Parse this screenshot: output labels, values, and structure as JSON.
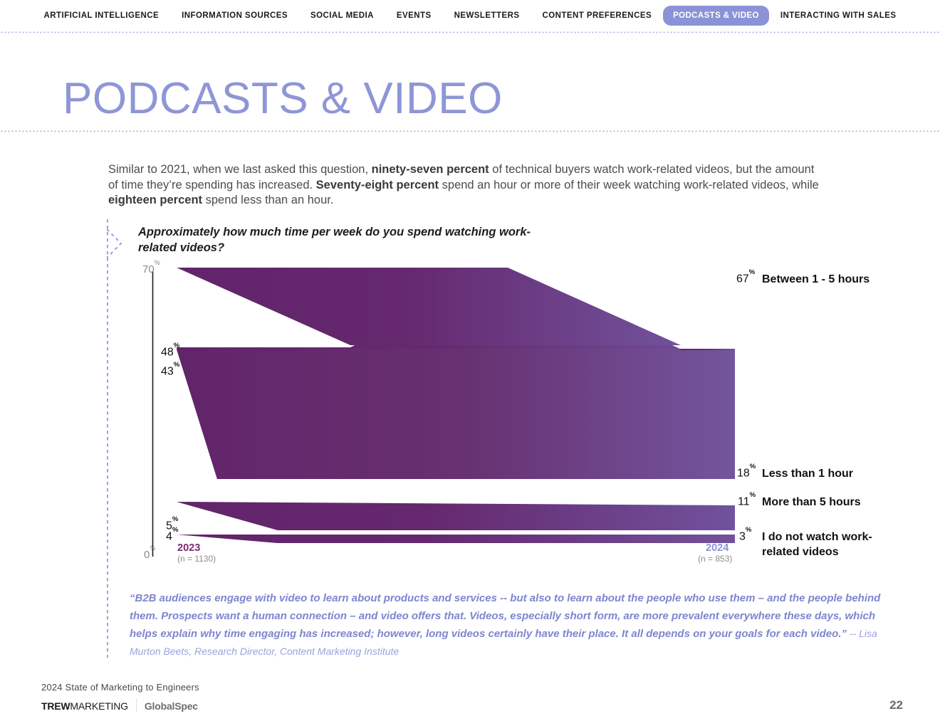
{
  "nav": {
    "items": [
      {
        "label": "ARTIFICIAL INTELLIGENCE",
        "active": false
      },
      {
        "label": "INFORMATION SOURCES",
        "active": false
      },
      {
        "label": "SOCIAL MEDIA",
        "active": false
      },
      {
        "label": "EVENTS",
        "active": false
      },
      {
        "label": "NEWSLETTERS",
        "active": false
      },
      {
        "label": "CONTENT PREFERENCES",
        "active": false
      },
      {
        "label": "PODCASTS & VIDEO",
        "active": true
      },
      {
        "label": "INTERACTING WITH SALES",
        "active": false
      }
    ],
    "active_pill_color": "#8b93d6"
  },
  "page": {
    "title": "PODCASTS & VIDEO",
    "title_color": "#8e96d6",
    "intro": {
      "part1": "Similar to 2021, when we last asked this question, ",
      "bold1": "ninety-seven percent",
      "part2": " of technical buyers watch work-related videos, but the amount of time they’re spending has increased. ",
      "bold2": "Seventy-eight percent",
      "part3": " spend an hour or more of their week watching work-related videos, while ",
      "bold3": "eighteen percent",
      "part4": " spend less than an hour."
    }
  },
  "quote": {
    "text": "“B2B audiences engage with video to learn about products and services -- but also to learn about the people who use them – and the people behind them. Prospects want a human connection – and video offers that. Videos, especially short form, are more prevalent everywhere these days, which helps explain why time engaging has increased; however, long videos certainly have their place. It all depends on your goals for each video.”",
    "attribution": " -- Lisa Murton Beets, Research Director, Content Marketing Institute",
    "color": "#7d86cf"
  },
  "footer": {
    "report_title": "2024 State of Marketing to Engineers",
    "logo_trew_bold": "TREW",
    "logo_trew_thin": "MARKETING",
    "logo_globalspec": "GlobalSpec",
    "page_number": "22"
  },
  "chart_data": {
    "type": "line",
    "title": "Approximately how much time per week do you spend watching work-related videos?",
    "xlabel": "",
    "ylabel": "",
    "ylim": [
      0,
      70
    ],
    "grid": false,
    "legend": "right-labels",
    "axis_ticks": [
      "70%",
      "0%"
    ],
    "axis_tick_values": [
      70,
      0
    ],
    "categories": [
      "2023",
      "2024"
    ],
    "category_sublabels": [
      "(n = 1130)",
      "(n = 853)"
    ],
    "category_colors": [
      "#7b2a72",
      "#8b93d6"
    ],
    "series": [
      {
        "name": "Between 1 - 5 hours",
        "values": [
          48,
          67
        ],
        "left_label": "48%",
        "right_label": "67%"
      },
      {
        "name": "Less than 1 hour",
        "values": [
          43,
          18
        ],
        "left_label": "43%",
        "right_label": "18%"
      },
      {
        "name": "More than 5 hours",
        "values": [
          5,
          11
        ],
        "left_label": "5%",
        "right_label": "11%"
      },
      {
        "name": "I do not watch work-related videos",
        "values": [
          4,
          3
        ],
        "left_label": "4%",
        "right_label": "3%"
      }
    ],
    "colors": {
      "left": "#62246a",
      "right": "#70519a"
    }
  }
}
